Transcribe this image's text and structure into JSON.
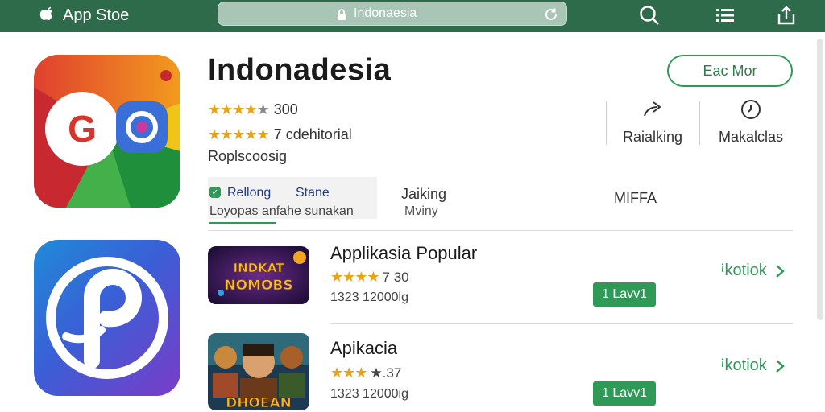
{
  "header": {
    "brand": "App Stoe",
    "url": "Indonaesia"
  },
  "app": {
    "title": "Indonadesia",
    "rating_stars": "★★★★",
    "rating_half": "★",
    "rating_value": "300",
    "review_stars": "★★★★★",
    "review_text": "7 cdehitorial",
    "developer": "Roplscoosig",
    "get_button": "Eac Mor"
  },
  "stats": [
    {
      "label": "Raialking",
      "icon": "share-arrow-icon"
    },
    {
      "label": "Makalclas",
      "icon": "clock-icon"
    }
  ],
  "tabs": {
    "tab1_top_a": "Rellong",
    "tab1_top_b": "Stane",
    "tab1_bottom": "Loyopas anfahe sunakan",
    "tab2_top": "Jaiking",
    "tab2_bottom": "Mviny",
    "tab3": "MIFFA"
  },
  "list": [
    {
      "title": "Applikasia Popular",
      "stars": "★★★★",
      "rating": "7 30",
      "meta": "1323 12000lg",
      "button": "1 Lavv1",
      "link": "ꜟkotiok",
      "thumb_text": "INDKAT NOMOBS"
    },
    {
      "title": "Apikacia",
      "stars": "★★★",
      "rating": "★.37",
      "meta": "1323 12000ig",
      "button": "1 Lavv1",
      "link": "ꜟkotiok",
      "thumb_text": "DHOEAN"
    }
  ],
  "colors": {
    "topbar": "#2e6b4b",
    "accent_green": "#2f9a57",
    "star": "#e8a317"
  }
}
